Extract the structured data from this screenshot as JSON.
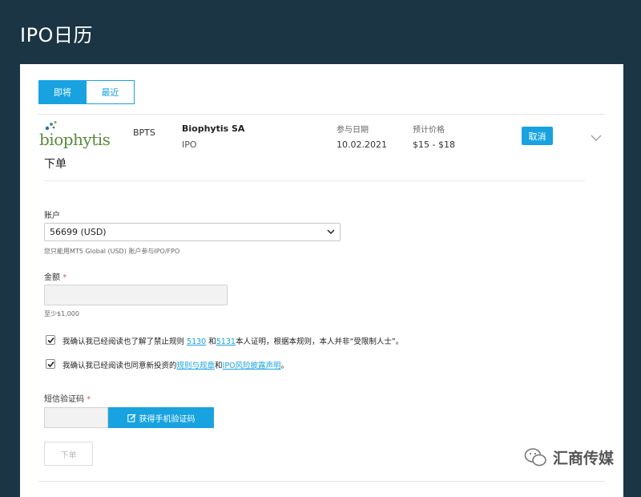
{
  "page": {
    "title": "IPO日历"
  },
  "tabs": [
    {
      "label": "即将",
      "active": true
    },
    {
      "label": "最近",
      "active": false
    }
  ],
  "ipo": {
    "logo_text": "biophytis",
    "ticker": "BPTS",
    "company": "Biophytis SA",
    "type": "IPO",
    "date_label": "参与日期",
    "date": "10.02.2021",
    "price_label": "预计价格",
    "price": "$15 - $18",
    "cancel_label": "取消"
  },
  "order": {
    "section_title": "下单",
    "account_label": "账户",
    "account_value": "56699 (USD)",
    "account_hint": "您只能用MT5 Global (USD) 账户参与IPO/FPO",
    "amount_label": "金额",
    "required_mark": "*",
    "amount_value": "",
    "amount_hint": "至少$1,000",
    "check1": {
      "checked": true,
      "prefix": "我确认我已经阅读也了解了禁止规则 ",
      "link1": "5130",
      "mid": " 和",
      "link2": "5131",
      "suffix": "本人证明，根据本规则，本人并非“受限制人士”。"
    },
    "check2": {
      "checked": true,
      "prefix": "我确认我已经阅读也同意新投资的",
      "link1": "规则与规章",
      "mid": "和",
      "link2": "IPO风险披露声明",
      "suffix": "。"
    },
    "sms_label": "短信验证码",
    "sms_value": "",
    "sms_button": "获得手机验证码",
    "submit_label": "下单"
  },
  "watermark": {
    "text": "汇商传媒"
  },
  "colors": {
    "accent": "#18a3e0",
    "header_bg": "#1b3545",
    "required": "#e05656",
    "logo_green": "#5a8a3a"
  }
}
